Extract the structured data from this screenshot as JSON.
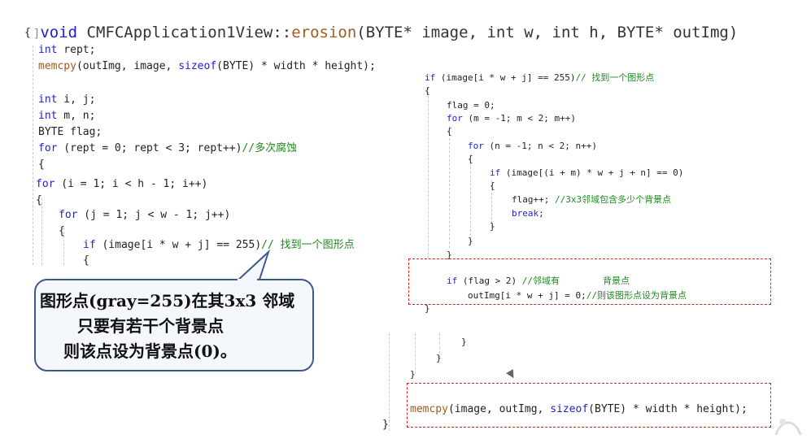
{
  "header": {
    "gutter": "]",
    "kw_void": "void",
    "cls": "CMFCApplication1View::",
    "fn": "erosion",
    "args": "(BYTE* image, int w, int h, BYTE* outImg)"
  },
  "left": [
    {
      "text": "{"
    },
    {
      "kw": "int",
      "text": " rept;"
    },
    {
      "fn": "memcpy",
      "text": "(outImg, image, ",
      "kw": "sizeof",
      "text2": "(BYTE) * width * height);"
    },
    {
      "kw": "int",
      "text": " i, j;"
    },
    {
      "kw": "int",
      "text": " m, n;"
    },
    {
      "text": "BYTE flag;"
    },
    {
      "kw": "for",
      "text": " (rept = 0; rept < 3; rept++)",
      "cm": "//多次腐蚀"
    },
    {
      "text": "{"
    },
    {
      "kw": "for",
      "text": " (i = 1; i < h - 1; i++)"
    },
    {
      "text": "{"
    },
    {
      "kw": "for",
      "text": " (j = 1; j < w - 1; j++)"
    },
    {
      "text": "{"
    },
    {
      "kw": "if",
      "text": " (image[i * w + j] == 255)",
      "cm": "// 找到一个图形点"
    },
    {
      "text": "{"
    }
  ],
  "right": [
    {
      "kw": "if",
      "text": " (image[i * w + j] == 255)",
      "cm": "// 找到一个图形点"
    },
    {
      "text": "{"
    },
    {
      "text": "flag = 0;"
    },
    {
      "kw": "for",
      "text": " (m = -1; m < 2; m++)"
    },
    {
      "text": "{"
    },
    {
      "kw": "for",
      "text": " (n = -1; n < 2; n++)"
    },
    {
      "text": "{"
    },
    {
      "kw": "if",
      "text": " (image[(i + m) * w + j + n] == 0)"
    },
    {
      "text": "{"
    },
    {
      "text": "flag++;",
      "cm": "//3x3邻域包含多少个背景点"
    },
    {
      "kw": "break",
      "text": ";"
    },
    {
      "text": "}"
    },
    {
      "text": "}"
    },
    {
      "text": "}"
    },
    {
      "kw": "if",
      "text": " (flag > 2)",
      "cm": "//邻域有        背景点"
    },
    {
      "text": "outImg[i * w + j] = 0;",
      "cm": "//则该图形点设为背景点"
    },
    {
      "text": "}"
    },
    {
      "text": "}"
    },
    {
      "text": "}"
    },
    {
      "text": "}"
    },
    {
      "fn": "memcpy",
      "text": "(image, outImg, ",
      "kw": "sizeof",
      "text2": "(BYTE) * width * height);"
    },
    {
      "text": "}"
    }
  ],
  "bubble": {
    "line1": "图形点(gray=255)在其3x3 邻域",
    "line2": "只要有若干个背景点",
    "line3": "则该点设为背景点(0)。"
  }
}
